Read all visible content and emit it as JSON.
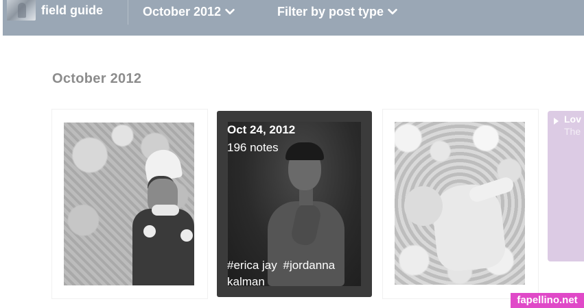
{
  "header": {
    "blog_title": "field guide",
    "month_selector_label": "October 2012",
    "filter_label": "Filter by post type"
  },
  "main": {
    "month_heading": "October 2012",
    "posts": [
      {
        "type": "photo",
        "icon": "photo-child-costume"
      },
      {
        "type": "photo",
        "icon": "photo-portrait",
        "overlay": {
          "date": "Oct 24, 2012",
          "notes": "196 notes",
          "tags": [
            "#erica jay",
            "#jordanna kalman"
          ]
        }
      },
      {
        "type": "photo",
        "icon": "photo-baby-floral"
      },
      {
        "type": "text",
        "title": "Lov",
        "body": "The"
      }
    ]
  },
  "watermark": "fapellino.net",
  "colors": {
    "header_bg": "#9aa7b5",
    "overlay_bg": "#3b3b3b",
    "text_post_bg": "#dccbe4",
    "watermark_bg": "#e049c8",
    "heading_text": "#8c8c8c"
  }
}
